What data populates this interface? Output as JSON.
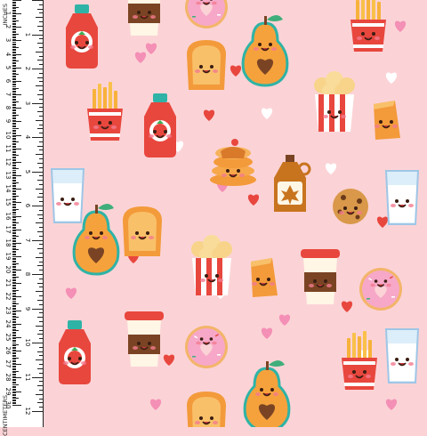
{
  "ruler": {
    "unit_label_inches": "INCHES",
    "unit_label_cm": "CENTIMETERS",
    "inches": [
      "1",
      "2",
      "3",
      "4",
      "5",
      "6",
      "7",
      "8",
      "9",
      "10",
      "11",
      "12"
    ],
    "centimeters": [
      "1",
      "2",
      "3",
      "4",
      "5",
      "6",
      "7",
      "8",
      "9",
      "10",
      "11",
      "12",
      "13",
      "14",
      "15",
      "16",
      "17",
      "18",
      "19",
      "20",
      "21",
      "22",
      "23",
      "24",
      "25",
      "26",
      "27",
      "28",
      "29",
      "30"
    ]
  },
  "colors": {
    "background": "#fbd3d6",
    "red": "#e8473e",
    "orange": "#f39a3a",
    "pear_green": "#f6a23c",
    "teal": "#2fb3a6",
    "brown": "#7a4424",
    "cream": "#fff6e6",
    "donut_pink": "#f7a8c8",
    "heart_pink": "#f48fb5",
    "white": "#ffffff"
  },
  "pattern": {
    "motifs": [
      "ketchup-bottle",
      "french-fries",
      "pear",
      "toast",
      "popcorn",
      "pancakes",
      "maple-syrup",
      "cookie",
      "milk-glass",
      "coffee-cup",
      "donut",
      "cheese",
      "heart"
    ]
  }
}
